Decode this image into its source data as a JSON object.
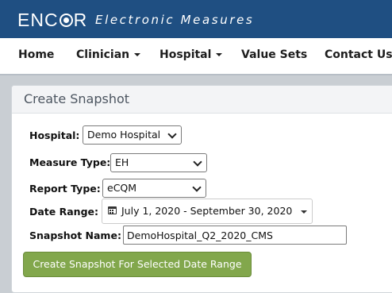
{
  "header": {
    "logo_prefix": "ENC",
    "logo_suffix": "R",
    "tagline": "Electronic Measures",
    "background_color": "#1f4f82"
  },
  "nav": {
    "items": [
      {
        "label": "Home",
        "has_dropdown": false
      },
      {
        "label": "Clinician",
        "has_dropdown": true
      },
      {
        "label": "Hospital",
        "has_dropdown": true
      },
      {
        "label": "Value Sets",
        "has_dropdown": false
      },
      {
        "label": "Contact Us",
        "has_dropdown": false
      }
    ]
  },
  "panel": {
    "title": "Create Snapshot"
  },
  "form": {
    "hospital": {
      "label": "Hospital:",
      "value": "Demo Hospital"
    },
    "measure_type": {
      "label": "Measure Type:",
      "value": "EH"
    },
    "report_type": {
      "label": "Report Type:",
      "value": "eCQM"
    },
    "date_range": {
      "label": "Date Range:",
      "value": "July 1, 2020 - September 30, 2020",
      "icon": "calendar-icon"
    },
    "snapshot_name": {
      "label": "Snapshot Name:",
      "value": "DemoHospital_Q2_2020_CMS"
    },
    "submit_label": "Create Snapshot For Selected Date Range",
    "submit_color": "#82a74c"
  }
}
